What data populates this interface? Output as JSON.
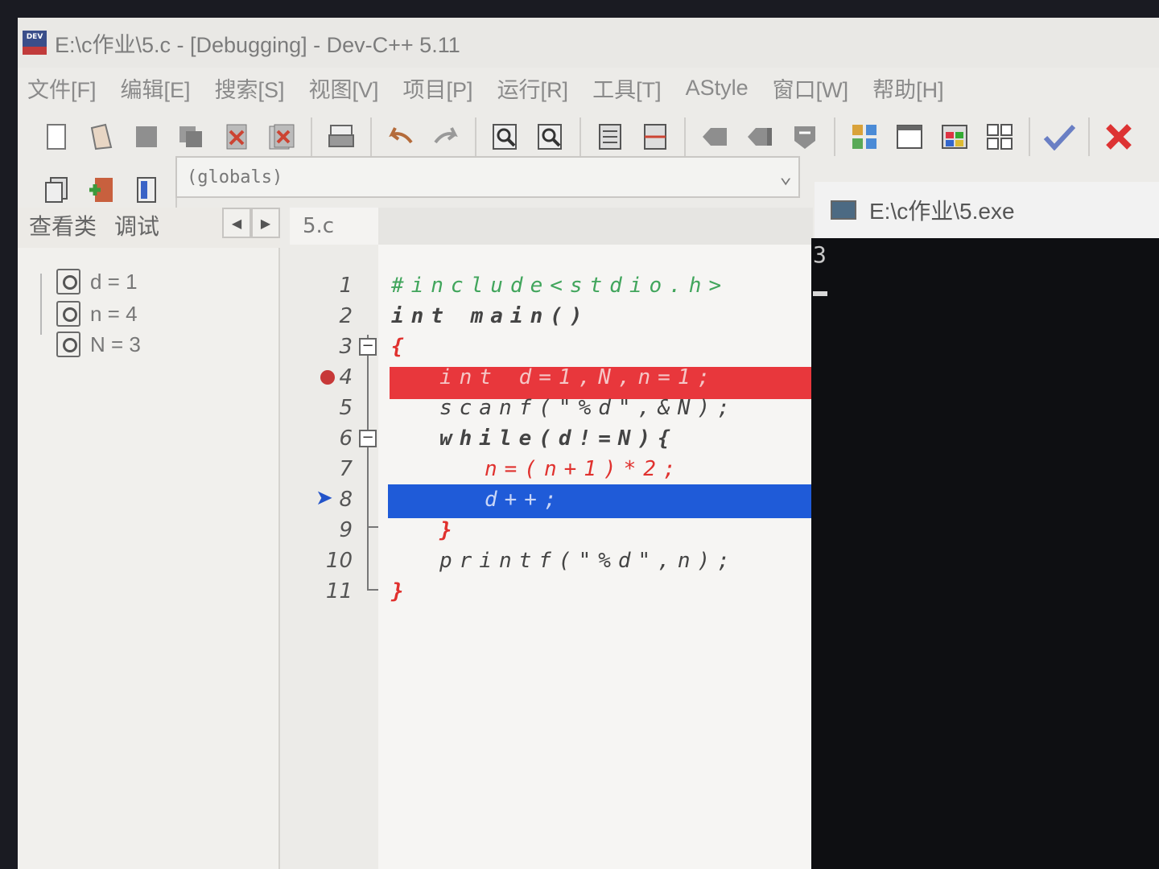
{
  "window": {
    "title": "E:\\c作业\\5.c - [Debugging] - Dev-C++ 5.11",
    "app_icon_text": "DEV"
  },
  "menu": [
    "文件[F]",
    "编辑[E]",
    "搜索[S]",
    "视图[V]",
    "项目[P]",
    "运行[R]",
    "工具[T]",
    "AStyle",
    "窗口[W]",
    "帮助[H]"
  ],
  "toolbar": {
    "icons": [
      "new-file-icon",
      "open-file-icon",
      "save-icon",
      "save-all-icon",
      "close-icon",
      "close-all-icon",
      "print-icon",
      "undo-icon",
      "redo-icon",
      "find-icon",
      "replace-icon",
      "indent-icon",
      "unindent-icon",
      "bookmark-prev-icon",
      "bookmark-next-icon",
      "toggle-comment-icon",
      "compile-icon",
      "run-icon",
      "compile-run-icon",
      "rebuild-icon",
      "check-icon",
      "stop-icon"
    ]
  },
  "scope_selector": {
    "value": "(globals)"
  },
  "left_panel": {
    "tabs": [
      "查看类",
      "调试"
    ],
    "watches": [
      {
        "label": "d = 1"
      },
      {
        "label": "n = 4"
      },
      {
        "label": "N = 3"
      }
    ]
  },
  "editor": {
    "tab": "5.c",
    "lines": [
      {
        "no": "1",
        "code": "#include<stdio.h>"
      },
      {
        "no": "2",
        "code": "int main()"
      },
      {
        "no": "3",
        "code": "{"
      },
      {
        "no": "4",
        "code": "int d=1,N,n=1;"
      },
      {
        "no": "5",
        "code": "scanf(\"%d\",&N);"
      },
      {
        "no": "6",
        "code": "while(d!=N){"
      },
      {
        "no": "7",
        "code": "n=(n+1)*2;"
      },
      {
        "no": "8",
        "code": "d++;"
      },
      {
        "no": "9",
        "code": "}"
      },
      {
        "no": "10",
        "code": "printf(\"%d\",n);"
      },
      {
        "no": "11",
        "code": "}"
      }
    ]
  },
  "console": {
    "title": "E:\\c作业\\5.exe",
    "output": "3"
  }
}
